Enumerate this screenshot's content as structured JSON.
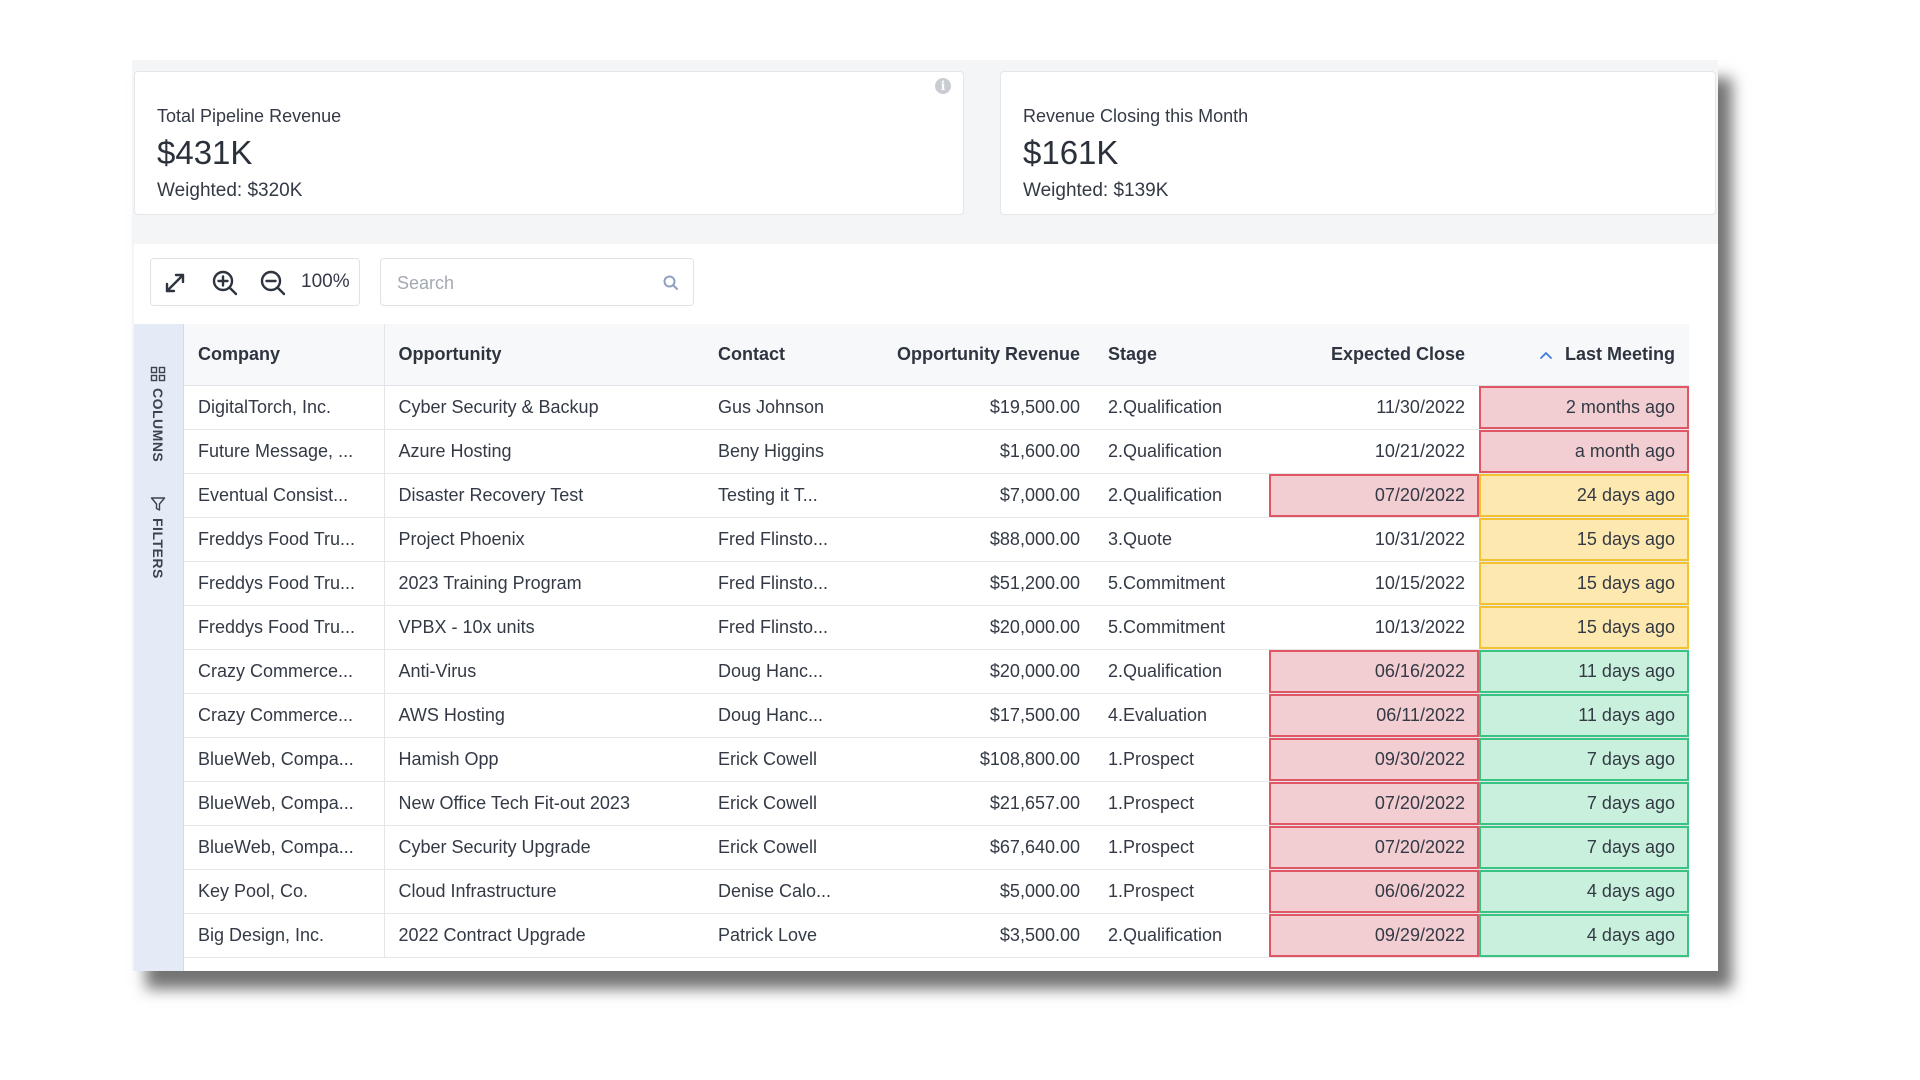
{
  "cards": [
    {
      "title": "Total Pipeline Revenue",
      "value": "$431K",
      "weighted": "Weighted: $320K",
      "info_icon": "i"
    },
    {
      "title": "Revenue Closing this Month",
      "value": "$161K",
      "weighted": "Weighted: $139K"
    }
  ],
  "toolbar": {
    "zoom_level": "100%",
    "icons": [
      "expand-icon",
      "zoom-in-icon",
      "zoom-out-icon"
    ],
    "search_placeholder": "Search",
    "search_value": ""
  },
  "side_bar": {
    "columns_label": "COLUMNS",
    "filters_label": "FILTERS"
  },
  "table": {
    "headers": {
      "company": "Company",
      "opportunity": "Opportunity",
      "contact": "Contact",
      "revenue": "Opportunity Revenue",
      "stage": "Stage",
      "close": "Expected Close",
      "meeting": "Last Meeting"
    },
    "sort": {
      "column": "meeting",
      "direction": "ascending"
    },
    "highlight_colors": {
      "red": {
        "fill": "#f2cdd2",
        "border": "#e05665"
      },
      "yellow": {
        "fill": "#fde8b0",
        "border": "#f2c233"
      },
      "green": {
        "fill": "#c8f0dc",
        "border": "#39c483"
      }
    },
    "rows": [
      {
        "company": "DigitalTorch, Inc.",
        "opportunity": "Cyber Security & Backup",
        "contact": "Gus Johnson",
        "revenue": "$19,500.00",
        "stage": "2.Qualification",
        "close": "11/30/2022",
        "close_status": "",
        "meeting": "2 months ago",
        "meeting_status": "red"
      },
      {
        "company": "Future Message, ...",
        "opportunity": "Azure Hosting",
        "contact": "Beny Higgins",
        "revenue": "$1,600.00",
        "stage": "2.Qualification",
        "close": "10/21/2022",
        "close_status": "",
        "meeting": "a month ago",
        "meeting_status": "red"
      },
      {
        "company": "Eventual Consist...",
        "opportunity": "Disaster Recovery Test",
        "contact": "Testing it T...",
        "revenue": "$7,000.00",
        "stage": "2.Qualification",
        "close": "07/20/2022",
        "close_status": "red",
        "meeting": "24 days ago",
        "meeting_status": "yellow"
      },
      {
        "company": "Freddys Food Tru...",
        "opportunity": "Project Phoenix",
        "contact": "Fred Flinsto...",
        "revenue": "$88,000.00",
        "stage": "3.Quote",
        "close": "10/31/2022",
        "close_status": "",
        "meeting": "15 days ago",
        "meeting_status": "yellow"
      },
      {
        "company": "Freddys Food Tru...",
        "opportunity": "2023 Training Program",
        "contact": "Fred Flinsto...",
        "revenue": "$51,200.00",
        "stage": "5.Commitment",
        "close": "10/15/2022",
        "close_status": "",
        "meeting": "15 days ago",
        "meeting_status": "yellow"
      },
      {
        "company": "Freddys Food Tru...",
        "opportunity": "VPBX - 10x units",
        "contact": "Fred Flinsto...",
        "revenue": "$20,000.00",
        "stage": "5.Commitment",
        "close": "10/13/2022",
        "close_status": "",
        "meeting": "15 days ago",
        "meeting_status": "yellow"
      },
      {
        "company": "Crazy Commerce...",
        "opportunity": "Anti-Virus",
        "contact": "Doug Hanc...",
        "revenue": "$20,000.00",
        "stage": "2.Qualification",
        "close": "06/16/2022",
        "close_status": "red",
        "meeting": "11 days ago",
        "meeting_status": "green"
      },
      {
        "company": "Crazy Commerce...",
        "opportunity": "AWS Hosting",
        "contact": "Doug Hanc...",
        "revenue": "$17,500.00",
        "stage": "4.Evaluation",
        "close": "06/11/2022",
        "close_status": "red",
        "meeting": "11 days ago",
        "meeting_status": "green"
      },
      {
        "company": "BlueWeb, Compa...",
        "opportunity": "Hamish Opp",
        "contact": "Erick Cowell",
        "revenue": "$108,800.00",
        "stage": "1.Prospect",
        "close": "09/30/2022",
        "close_status": "red",
        "meeting": "7 days ago",
        "meeting_status": "green"
      },
      {
        "company": "BlueWeb, Compa...",
        "opportunity": "New Office Tech Fit-out 2023",
        "contact": "Erick Cowell",
        "revenue": "$21,657.00",
        "stage": "1.Prospect",
        "close": "07/20/2022",
        "close_status": "red",
        "meeting": "7 days ago",
        "meeting_status": "green"
      },
      {
        "company": "BlueWeb, Compa...",
        "opportunity": "Cyber Security Upgrade",
        "contact": "Erick Cowell",
        "revenue": "$67,640.00",
        "stage": "1.Prospect",
        "close": "07/20/2022",
        "close_status": "red",
        "meeting": "7 days ago",
        "meeting_status": "green"
      },
      {
        "company": "Key Pool, Co.",
        "opportunity": "Cloud Infrastructure",
        "contact": "Denise Calo...",
        "revenue": "$5,000.00",
        "stage": "1.Prospect",
        "close": "06/06/2022",
        "close_status": "red",
        "meeting": "4 days ago",
        "meeting_status": "green"
      },
      {
        "company": "Big Design, Inc.",
        "opportunity": "2022 Contract Upgrade",
        "contact": "Patrick Love",
        "revenue": "$3,500.00",
        "stage": "2.Qualification",
        "close": "09/29/2022",
        "close_status": "red",
        "meeting": "4 days ago",
        "meeting_status": "green"
      }
    ]
  }
}
